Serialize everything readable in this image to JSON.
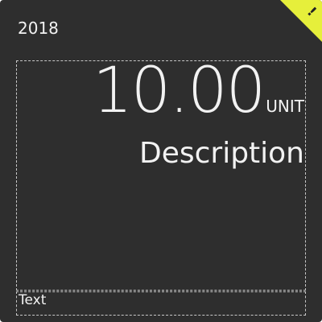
{
  "tile": {
    "year": "2018",
    "value": "10.00",
    "unit": "UNIT",
    "description": "Description",
    "footer_text": "Text",
    "corner_mark": "!",
    "corner_icon": "alert-corner-icon",
    "colors": {
      "background": "#2e2e2e",
      "accent": "#e6ef3b",
      "text": "#f2f2f2",
      "dashed_border": "#c8c8c8"
    }
  }
}
